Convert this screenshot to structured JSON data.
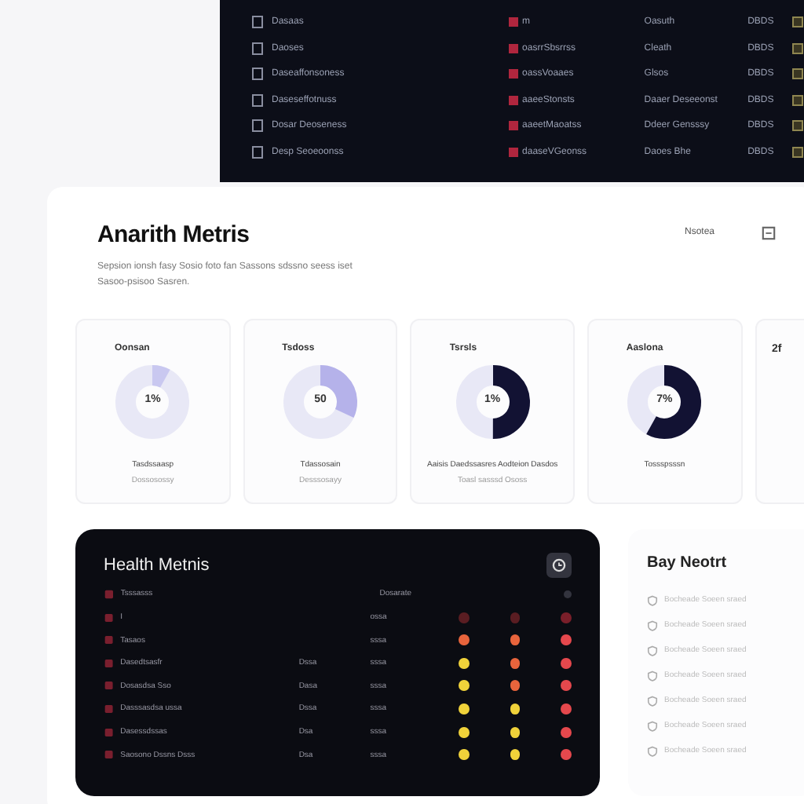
{
  "top_table": {
    "rows": [
      {
        "name": "Dasaas",
        "tag": "m",
        "status": "Oasuth",
        "code": "DBDS"
      },
      {
        "name": "Daoses",
        "tag": "oasrrSbsrrss",
        "status": "Cleath",
        "code": "DBDS"
      },
      {
        "name": "Daseaffonsoness",
        "tag": "oassVoaaes",
        "status": "Glsos",
        "code": "DBDS"
      },
      {
        "name": "Daseseffotnuss",
        "tag": "aaeeStonsts",
        "status": "Daaer Deseeonst",
        "code": "DBDS"
      },
      {
        "name": "Dosar Deoseness",
        "tag": "aaeetMaoatss",
        "status": "Ddeer Gensssy",
        "code": "DBDS"
      },
      {
        "name": "Desp Seoeoonss",
        "tag": "daaseVGeonss",
        "status": "Daoes Bhe",
        "code": "DBDS"
      }
    ]
  },
  "analytics": {
    "title": "Anarith Metris",
    "subtitle": "Sepsion ionsh fasy Sosio foto fan Sassons sdssno seess iset Sasoo-psisoo Sasren.",
    "action": "Nsotea",
    "metrics": [
      {
        "label": "Oonsan",
        "value": "1%",
        "level": 0.08,
        "color": "#c9c8f0",
        "caption": "Tasdssaasp",
        "note": "Dossosossy"
      },
      {
        "label": "Tsdoss",
        "value": "50",
        "level": 0.32,
        "color": "#b5b2ea",
        "caption": "Tdassosain",
        "note": "Desssosayy"
      },
      {
        "label": "Tsrsls",
        "value": "1%",
        "level": 0.5,
        "color": "#121233",
        "caption": "Aaisis Daedssasres Aodteion Dasdos",
        "note": "Toasl sasssd Ososs"
      },
      {
        "label": "Aaslona",
        "value": "7%",
        "level": 0.58,
        "color": "#121233",
        "caption": "Tossspsssn"
      }
    ],
    "partial_label": "2f"
  },
  "health": {
    "title": "Health Metnis",
    "rows": [
      {
        "name": "Tsssasss",
        "col_2": "",
        "col_3": "Dosarate",
        "dots": [
          {
            "color": "#33343e"
          }
        ]
      },
      {
        "name": "I",
        "col_2": "",
        "col_3": "ossa",
        "dots": [
          {
            "color": "#5a1d22"
          },
          {
            "color": "#5a1d22"
          },
          {
            "color": "#7a1f2a"
          }
        ]
      },
      {
        "name": "Tasaos",
        "col_2": "",
        "col_3": "sssa",
        "dots": [
          {
            "color": "#e8643c"
          },
          {
            "color": "#e8643c"
          },
          {
            "color": "#e5484d"
          }
        ]
      },
      {
        "name": "Dasedtsasfr",
        "col_2": "Dssa",
        "col_3": "sssa",
        "dots": [
          {
            "color": "#f0d23a"
          },
          {
            "color": "#e8643c"
          },
          {
            "color": "#e5484d"
          }
        ]
      },
      {
        "name": "Dosasdsa Sso",
        "col_2": "Dasa",
        "col_3": "sssa",
        "dots": [
          {
            "color": "#f0d23a"
          },
          {
            "color": "#e8643c"
          },
          {
            "color": "#e5484d"
          }
        ]
      },
      {
        "name": "Dasssasdsa ussa",
        "col_2": "Dssa",
        "col_3": "sssa",
        "dots": [
          {
            "color": "#f0d23a"
          },
          {
            "color": "#f0d23a"
          },
          {
            "color": "#e5484d"
          }
        ]
      },
      {
        "name": "Dasessdssas",
        "col_2": "Dsa",
        "col_3": "sssa",
        "dots": [
          {
            "color": "#f0d23a"
          },
          {
            "color": "#f0d23a"
          },
          {
            "color": "#e5484d"
          }
        ]
      },
      {
        "name": "Saosono Dssns Dsss",
        "col_2": "Dsa",
        "col_3": "sssa",
        "dots": [
          {
            "color": "#f0d23a"
          },
          {
            "color": "#f0d23a"
          },
          {
            "color": "#e5484d"
          }
        ]
      }
    ]
  },
  "report": {
    "title": "Bay Neotrt",
    "items": [
      "Bocheade Soeen sraed",
      "Bocheade Soeen sraed",
      "Bocheade Soeen sraed",
      "Bocheade Soeen sraed",
      "Bocheade Soeen sraed",
      "Bocheade Soeen sraed",
      "Bocheade Soeen sraed"
    ]
  }
}
